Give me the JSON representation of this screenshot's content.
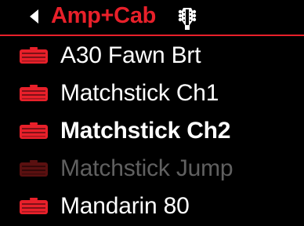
{
  "header": {
    "title": "Amp+Cab",
    "back_icon": "chevron-left-icon",
    "category_icon": "guitar-headstock-icon"
  },
  "colors": {
    "accent": "#e8202a",
    "text": "#ffffff",
    "text_disabled": "#606060",
    "amp_icon_disabled": "#5a1010",
    "background": "#000000"
  },
  "list": {
    "items": [
      {
        "label": "A30 Fawn Brt",
        "icon": "amp-icon",
        "state": "normal"
      },
      {
        "label": "Matchstick Ch1",
        "icon": "amp-icon",
        "state": "normal"
      },
      {
        "label": "Matchstick Ch2",
        "icon": "amp-icon",
        "state": "selected"
      },
      {
        "label": "Matchstick Jump",
        "icon": "amp-icon",
        "state": "disabled"
      },
      {
        "label": "Mandarin 80",
        "icon": "amp-icon",
        "state": "normal"
      }
    ]
  }
}
